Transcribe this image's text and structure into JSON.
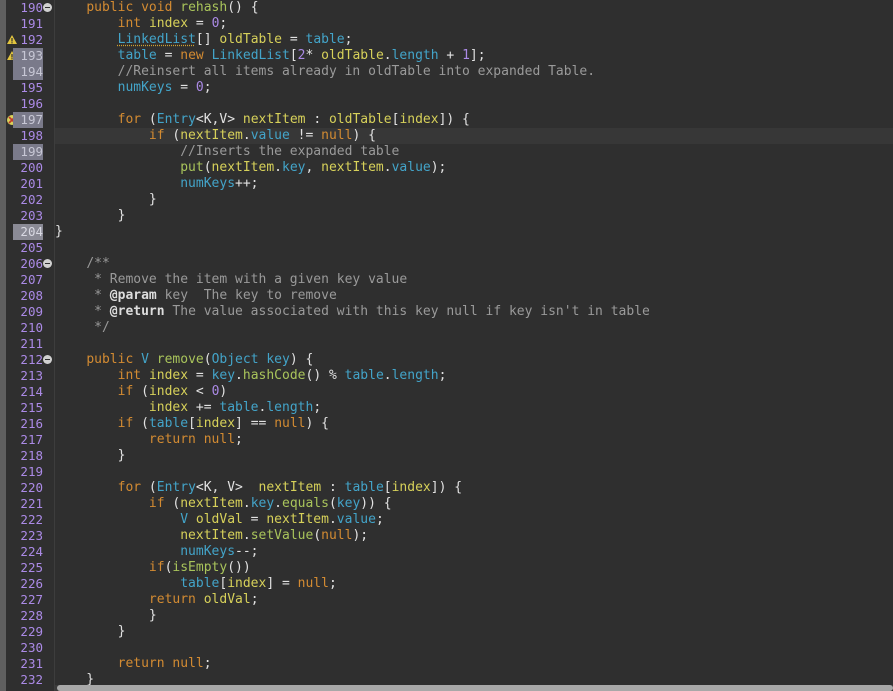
{
  "editor": {
    "colors": {
      "background": "#2f2f2f",
      "gutter": "#2f2f2f",
      "keyword": "#d38b32",
      "type": "#43a4c9",
      "identifier": "#d7d15a",
      "function": "#a9c45b",
      "comment": "#9a9a9a",
      "number": "#ab8ae6"
    },
    "lines": [
      {
        "n": "190",
        "fold": true,
        "tokens": [
          {
            "t": "    ",
            "c": "tx"
          },
          {
            "t": "public",
            "c": "kw"
          },
          {
            "t": " ",
            "c": "tx"
          },
          {
            "t": "void",
            "c": "kw"
          },
          {
            "t": " ",
            "c": "tx"
          },
          {
            "t": "rehash",
            "c": "fn"
          },
          {
            "t": "() {",
            "c": "tx"
          }
        ]
      },
      {
        "n": "191",
        "tokens": [
          {
            "t": "        ",
            "c": "tx"
          },
          {
            "t": "int",
            "c": "kw"
          },
          {
            "t": " ",
            "c": "tx"
          },
          {
            "t": "index",
            "c": "id"
          },
          {
            "t": " = ",
            "c": "tx"
          },
          {
            "t": "0",
            "c": "num"
          },
          {
            "t": ";",
            "c": "tx"
          }
        ]
      },
      {
        "n": "192",
        "marker": "warn",
        "tokens": [
          {
            "t": "        ",
            "c": "tx"
          },
          {
            "t": "LinkedList",
            "c": "ty under"
          },
          {
            "t": "[] ",
            "c": "tx"
          },
          {
            "t": "oldTable",
            "c": "id"
          },
          {
            "t": " = ",
            "c": "tx"
          },
          {
            "t": "table",
            "c": "ty"
          },
          {
            "t": ";",
            "c": "tx"
          }
        ]
      },
      {
        "n": "193",
        "marker": "warn",
        "hl": true,
        "tokens": [
          {
            "t": "        ",
            "c": "tx"
          },
          {
            "t": "table",
            "c": "ty"
          },
          {
            "t": " = ",
            "c": "tx"
          },
          {
            "t": "new",
            "c": "kw"
          },
          {
            "t": " ",
            "c": "tx"
          },
          {
            "t": "LinkedList",
            "c": "ty"
          },
          {
            "t": "[",
            "c": "tx"
          },
          {
            "t": "2",
            "c": "num"
          },
          {
            "t": "* ",
            "c": "tx"
          },
          {
            "t": "oldTable",
            "c": "id"
          },
          {
            "t": ".",
            "c": "tx"
          },
          {
            "t": "length",
            "c": "ty"
          },
          {
            "t": " + ",
            "c": "tx"
          },
          {
            "t": "1",
            "c": "num"
          },
          {
            "t": "];",
            "c": "tx"
          }
        ]
      },
      {
        "n": "194",
        "hl": true,
        "tokens": [
          {
            "t": "        ",
            "c": "tx"
          },
          {
            "t": "//Reinsert all items already in oldTable into expanded Table.",
            "c": "cm"
          }
        ]
      },
      {
        "n": "195",
        "tokens": [
          {
            "t": "        ",
            "c": "tx"
          },
          {
            "t": "numKeys",
            "c": "ty"
          },
          {
            "t": " = ",
            "c": "tx"
          },
          {
            "t": "0",
            "c": "num"
          },
          {
            "t": ";",
            "c": "tx"
          }
        ]
      },
      {
        "n": "196",
        "tokens": []
      },
      {
        "n": "197",
        "marker": "error",
        "hl": true,
        "tokens": [
          {
            "t": "        ",
            "c": "tx"
          },
          {
            "t": "for",
            "c": "kw"
          },
          {
            "t": " (",
            "c": "tx"
          },
          {
            "t": "Entry",
            "c": "ty"
          },
          {
            "t": "<K,V> ",
            "c": "tx"
          },
          {
            "t": "nextItem",
            "c": "id"
          },
          {
            "t": " : ",
            "c": "tx"
          },
          {
            "t": "oldTable",
            "c": "id"
          },
          {
            "t": "[",
            "c": "tx"
          },
          {
            "t": "index",
            "c": "id"
          },
          {
            "t": "]) {",
            "c": "tx"
          }
        ]
      },
      {
        "n": "198",
        "current": true,
        "tokens": [
          {
            "t": "            ",
            "c": "tx"
          },
          {
            "t": "if",
            "c": "kw"
          },
          {
            "t": " (",
            "c": "tx"
          },
          {
            "t": "nextItem",
            "c": "id"
          },
          {
            "t": ".",
            "c": "tx"
          },
          {
            "t": "value",
            "c": "ty"
          },
          {
            "t": " != ",
            "c": "tx"
          },
          {
            "t": "null",
            "c": "kw"
          },
          {
            "t": ") {",
            "c": "tx"
          }
        ]
      },
      {
        "n": "199",
        "hl": true,
        "tokens": [
          {
            "t": "                ",
            "c": "tx"
          },
          {
            "t": "//Inserts the expanded table",
            "c": "cm"
          }
        ]
      },
      {
        "n": "200",
        "tokens": [
          {
            "t": "                ",
            "c": "tx"
          },
          {
            "t": "put",
            "c": "fn"
          },
          {
            "t": "(",
            "c": "tx"
          },
          {
            "t": "nextItem",
            "c": "id"
          },
          {
            "t": ".",
            "c": "tx"
          },
          {
            "t": "key",
            "c": "ty"
          },
          {
            "t": ", ",
            "c": "tx"
          },
          {
            "t": "nextItem",
            "c": "id"
          },
          {
            "t": ".",
            "c": "tx"
          },
          {
            "t": "value",
            "c": "ty"
          },
          {
            "t": ");",
            "c": "tx"
          }
        ]
      },
      {
        "n": "201",
        "tokens": [
          {
            "t": "                ",
            "c": "tx"
          },
          {
            "t": "numKeys",
            "c": "ty"
          },
          {
            "t": "++;",
            "c": "tx"
          }
        ]
      },
      {
        "n": "202",
        "tokens": [
          {
            "t": "            }",
            "c": "tx"
          }
        ]
      },
      {
        "n": "203",
        "tokens": [
          {
            "t": "        }",
            "c": "tx"
          }
        ]
      },
      {
        "n": "204",
        "hl": true,
        "white": true,
        "tokens": [
          {
            "t": "}",
            "c": "tx"
          }
        ]
      },
      {
        "n": "205",
        "tokens": []
      },
      {
        "n": "206",
        "fold": true,
        "tokens": [
          {
            "t": "    ",
            "c": "tx"
          },
          {
            "t": "/**",
            "c": "cm"
          }
        ]
      },
      {
        "n": "207",
        "tokens": [
          {
            "t": "     * Remove the item with a given key value",
            "c": "cm"
          }
        ]
      },
      {
        "n": "208",
        "tokens": [
          {
            "t": "     * ",
            "c": "cm"
          },
          {
            "t": "@param",
            "c": "tag"
          },
          {
            "t": " key  The key to remove",
            "c": "cm"
          }
        ]
      },
      {
        "n": "209",
        "tokens": [
          {
            "t": "     * ",
            "c": "cm"
          },
          {
            "t": "@return",
            "c": "tag"
          },
          {
            "t": " The value associated with this key null if key isn't in table",
            "c": "cm"
          }
        ]
      },
      {
        "n": "210",
        "tokens": [
          {
            "t": "     */",
            "c": "cm"
          }
        ]
      },
      {
        "n": "211",
        "tokens": []
      },
      {
        "n": "212",
        "fold": true,
        "tokens": [
          {
            "t": "    ",
            "c": "tx"
          },
          {
            "t": "public",
            "c": "kw"
          },
          {
            "t": " ",
            "c": "tx"
          },
          {
            "t": "V",
            "c": "ty"
          },
          {
            "t": " ",
            "c": "tx"
          },
          {
            "t": "remove",
            "c": "fn"
          },
          {
            "t": "(",
            "c": "tx"
          },
          {
            "t": "Object",
            "c": "ty"
          },
          {
            "t": " ",
            "c": "tx"
          },
          {
            "t": "key",
            "c": "ty"
          },
          {
            "t": ") {",
            "c": "tx"
          }
        ]
      },
      {
        "n": "213",
        "tokens": [
          {
            "t": "        ",
            "c": "tx"
          },
          {
            "t": "int",
            "c": "kw"
          },
          {
            "t": " ",
            "c": "tx"
          },
          {
            "t": "index",
            "c": "id"
          },
          {
            "t": " = ",
            "c": "tx"
          },
          {
            "t": "key",
            "c": "ty"
          },
          {
            "t": ".",
            "c": "tx"
          },
          {
            "t": "hashCode",
            "c": "fn"
          },
          {
            "t": "() % ",
            "c": "tx"
          },
          {
            "t": "table",
            "c": "ty"
          },
          {
            "t": ".",
            "c": "tx"
          },
          {
            "t": "length",
            "c": "ty"
          },
          {
            "t": ";",
            "c": "tx"
          }
        ]
      },
      {
        "n": "214",
        "tokens": [
          {
            "t": "        ",
            "c": "tx"
          },
          {
            "t": "if",
            "c": "kw"
          },
          {
            "t": " (",
            "c": "tx"
          },
          {
            "t": "index",
            "c": "id"
          },
          {
            "t": " < ",
            "c": "tx"
          },
          {
            "t": "0",
            "c": "num"
          },
          {
            "t": ")",
            "c": "tx"
          }
        ]
      },
      {
        "n": "215",
        "tokens": [
          {
            "t": "            ",
            "c": "tx"
          },
          {
            "t": "index",
            "c": "id"
          },
          {
            "t": " += ",
            "c": "tx"
          },
          {
            "t": "table",
            "c": "ty"
          },
          {
            "t": ".",
            "c": "tx"
          },
          {
            "t": "length",
            "c": "ty"
          },
          {
            "t": ";",
            "c": "tx"
          }
        ]
      },
      {
        "n": "216",
        "tokens": [
          {
            "t": "        ",
            "c": "tx"
          },
          {
            "t": "if",
            "c": "kw"
          },
          {
            "t": " (",
            "c": "tx"
          },
          {
            "t": "table",
            "c": "ty"
          },
          {
            "t": "[",
            "c": "tx"
          },
          {
            "t": "index",
            "c": "id"
          },
          {
            "t": "] == ",
            "c": "tx"
          },
          {
            "t": "null",
            "c": "kw"
          },
          {
            "t": ") {",
            "c": "tx"
          }
        ]
      },
      {
        "n": "217",
        "tokens": [
          {
            "t": "            ",
            "c": "tx"
          },
          {
            "t": "return",
            "c": "kw"
          },
          {
            "t": " ",
            "c": "tx"
          },
          {
            "t": "null",
            "c": "kw"
          },
          {
            "t": ";",
            "c": "tx"
          }
        ]
      },
      {
        "n": "218",
        "tokens": [
          {
            "t": "        }",
            "c": "tx"
          }
        ]
      },
      {
        "n": "219",
        "tokens": []
      },
      {
        "n": "220",
        "tokens": [
          {
            "t": "        ",
            "c": "tx"
          },
          {
            "t": "for",
            "c": "kw"
          },
          {
            "t": " (",
            "c": "tx"
          },
          {
            "t": "Entry",
            "c": "ty"
          },
          {
            "t": "<K, V>  ",
            "c": "tx"
          },
          {
            "t": "nextItem",
            "c": "id"
          },
          {
            "t": " : ",
            "c": "tx"
          },
          {
            "t": "table",
            "c": "ty"
          },
          {
            "t": "[",
            "c": "tx"
          },
          {
            "t": "index",
            "c": "id"
          },
          {
            "t": "]) {",
            "c": "tx"
          }
        ]
      },
      {
        "n": "221",
        "tokens": [
          {
            "t": "            ",
            "c": "tx"
          },
          {
            "t": "if",
            "c": "kw"
          },
          {
            "t": " (",
            "c": "tx"
          },
          {
            "t": "nextItem",
            "c": "id"
          },
          {
            "t": ".",
            "c": "tx"
          },
          {
            "t": "key",
            "c": "ty"
          },
          {
            "t": ".",
            "c": "tx"
          },
          {
            "t": "equals",
            "c": "fn"
          },
          {
            "t": "(",
            "c": "tx"
          },
          {
            "t": "key",
            "c": "ty"
          },
          {
            "t": ")) {",
            "c": "tx"
          }
        ]
      },
      {
        "n": "222",
        "tokens": [
          {
            "t": "                ",
            "c": "tx"
          },
          {
            "t": "V",
            "c": "ty"
          },
          {
            "t": " ",
            "c": "tx"
          },
          {
            "t": "oldVal",
            "c": "id"
          },
          {
            "t": " = ",
            "c": "tx"
          },
          {
            "t": "nextItem",
            "c": "id"
          },
          {
            "t": ".",
            "c": "tx"
          },
          {
            "t": "value",
            "c": "ty"
          },
          {
            "t": ";",
            "c": "tx"
          }
        ]
      },
      {
        "n": "223",
        "tokens": [
          {
            "t": "                ",
            "c": "tx"
          },
          {
            "t": "nextItem",
            "c": "id"
          },
          {
            "t": ".",
            "c": "tx"
          },
          {
            "t": "setValue",
            "c": "fn"
          },
          {
            "t": "(",
            "c": "tx"
          },
          {
            "t": "null",
            "c": "kw"
          },
          {
            "t": ");",
            "c": "tx"
          }
        ]
      },
      {
        "n": "224",
        "tokens": [
          {
            "t": "                ",
            "c": "tx"
          },
          {
            "t": "numKeys",
            "c": "ty"
          },
          {
            "t": "--;",
            "c": "tx"
          }
        ]
      },
      {
        "n": "225",
        "tokens": [
          {
            "t": "            ",
            "c": "tx"
          },
          {
            "t": "if",
            "c": "kw"
          },
          {
            "t": "(",
            "c": "tx"
          },
          {
            "t": "isEmpty",
            "c": "fn"
          },
          {
            "t": "())",
            "c": "tx"
          }
        ]
      },
      {
        "n": "226",
        "tokens": [
          {
            "t": "                ",
            "c": "tx"
          },
          {
            "t": "table",
            "c": "ty"
          },
          {
            "t": "[",
            "c": "tx"
          },
          {
            "t": "index",
            "c": "id"
          },
          {
            "t": "] = ",
            "c": "tx"
          },
          {
            "t": "null",
            "c": "kw"
          },
          {
            "t": ";",
            "c": "tx"
          }
        ]
      },
      {
        "n": "227",
        "tokens": [
          {
            "t": "            ",
            "c": "tx"
          },
          {
            "t": "return",
            "c": "kw"
          },
          {
            "t": " ",
            "c": "tx"
          },
          {
            "t": "oldVal",
            "c": "id"
          },
          {
            "t": ";",
            "c": "tx"
          }
        ]
      },
      {
        "n": "228",
        "tokens": [
          {
            "t": "            }",
            "c": "tx"
          }
        ]
      },
      {
        "n": "229",
        "tokens": [
          {
            "t": "        }",
            "c": "tx"
          }
        ]
      },
      {
        "n": "230",
        "tokens": []
      },
      {
        "n": "231",
        "tokens": [
          {
            "t": "        ",
            "c": "tx"
          },
          {
            "t": "return",
            "c": "kw"
          },
          {
            "t": " ",
            "c": "tx"
          },
          {
            "t": "null",
            "c": "kw"
          },
          {
            "t": ";",
            "c": "tx"
          }
        ]
      },
      {
        "n": "232",
        "tokens": [
          {
            "t": "    }",
            "c": "tx"
          }
        ]
      }
    ]
  }
}
